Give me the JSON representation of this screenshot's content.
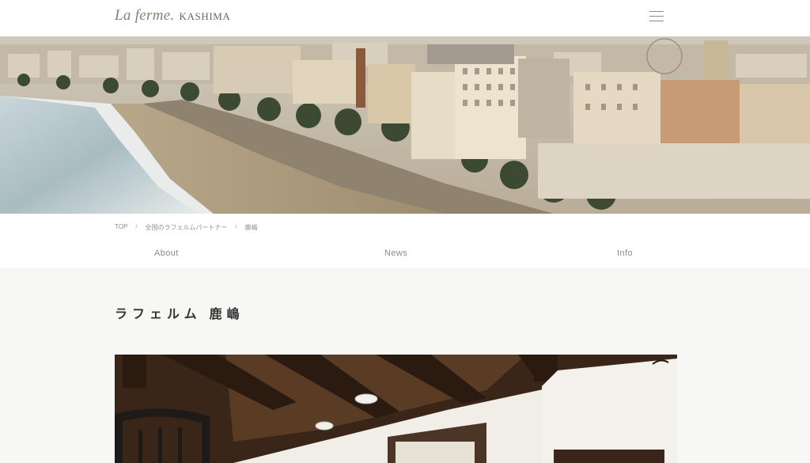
{
  "header": {
    "logo_script": "La ferme.",
    "logo_text": "KASHIMA",
    "menu_icon": "hamburger-menu-icon"
  },
  "hero": {
    "image": "coastal-city-promenade-photo"
  },
  "breadcrumb": {
    "items": [
      "TOP",
      "全国のラフェルムパートナー",
      "鹿嶋"
    ],
    "separator": "/"
  },
  "subnav": {
    "items": [
      "About",
      "News",
      "Info"
    ]
  },
  "page": {
    "title": "ラフェルム 鹿嶋"
  },
  "photo": {
    "image": "interior-wooden-beam-ceiling-photo"
  },
  "colors": {
    "header_bg": "#ffffff",
    "page_bg": "#f7f7f6",
    "logo": "#8a7f6c",
    "text_muted": "#8a8a8a",
    "title": "#333333"
  }
}
